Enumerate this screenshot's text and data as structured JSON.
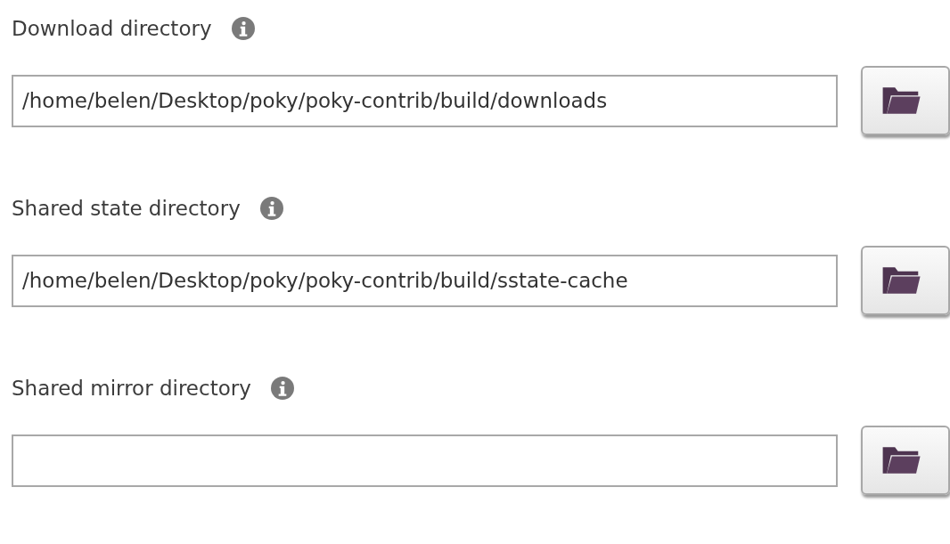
{
  "settings": [
    {
      "label": "Download directory",
      "value": "/home/belen/Desktop/poky/poky-contrib/build/downloads"
    },
    {
      "label": "Shared state directory",
      "value": "/home/belen/Desktop/poky/poky-contrib/build/sstate-cache"
    },
    {
      "label": "Shared mirror directory"
    }
  ]
}
